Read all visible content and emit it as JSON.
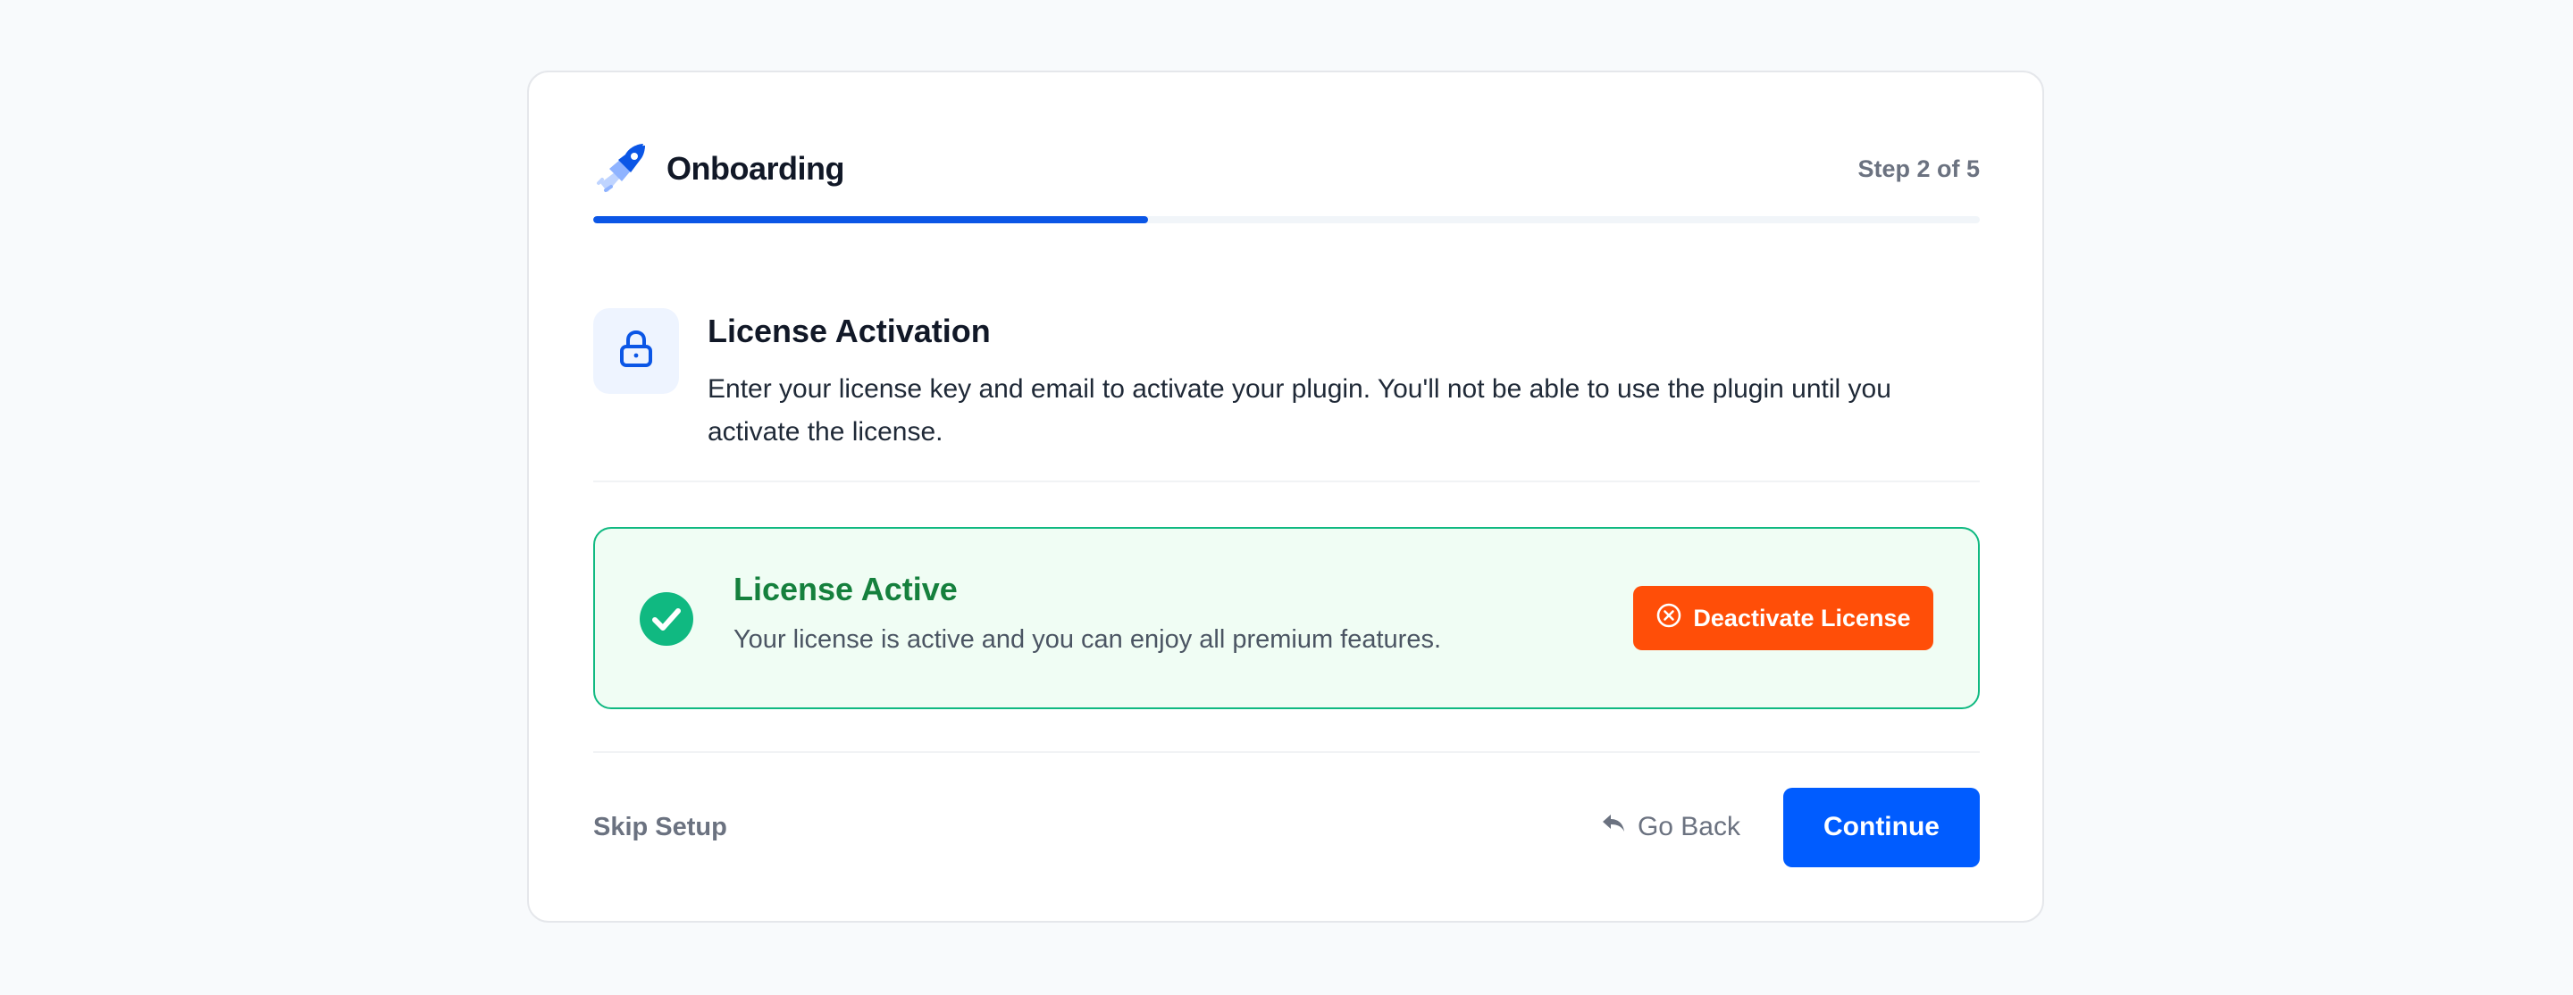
{
  "header": {
    "title": "Onboarding",
    "step": "Step 2 of 5",
    "logo_icon": "rocket-icon"
  },
  "progress": {
    "current_step": 2,
    "total_steps": 5,
    "fraction": 0.4,
    "color": "#0b56e6"
  },
  "section": {
    "icon": "lock-icon",
    "title": "License Activation",
    "description": "Enter your license key and email to activate your plugin. You'll not be able to use the plugin until you activate the license."
  },
  "status": {
    "icon": "check-circle-icon",
    "title": "License Active",
    "description": "Your license is active and you can enjoy all premium features.",
    "deactivate_label": "Deactivate License",
    "deactivate_icon": "close-circle-icon",
    "accent": "#15803d",
    "border": "#10b981",
    "background": "#f0fdf4"
  },
  "footer": {
    "skip_label": "Skip Setup",
    "back_label": "Go Back",
    "back_icon": "reply-arrow-icon",
    "continue_label": "Continue"
  },
  "colors": {
    "primary": "#005cff",
    "danger": "#ff4e08",
    "success": "#10b981"
  }
}
